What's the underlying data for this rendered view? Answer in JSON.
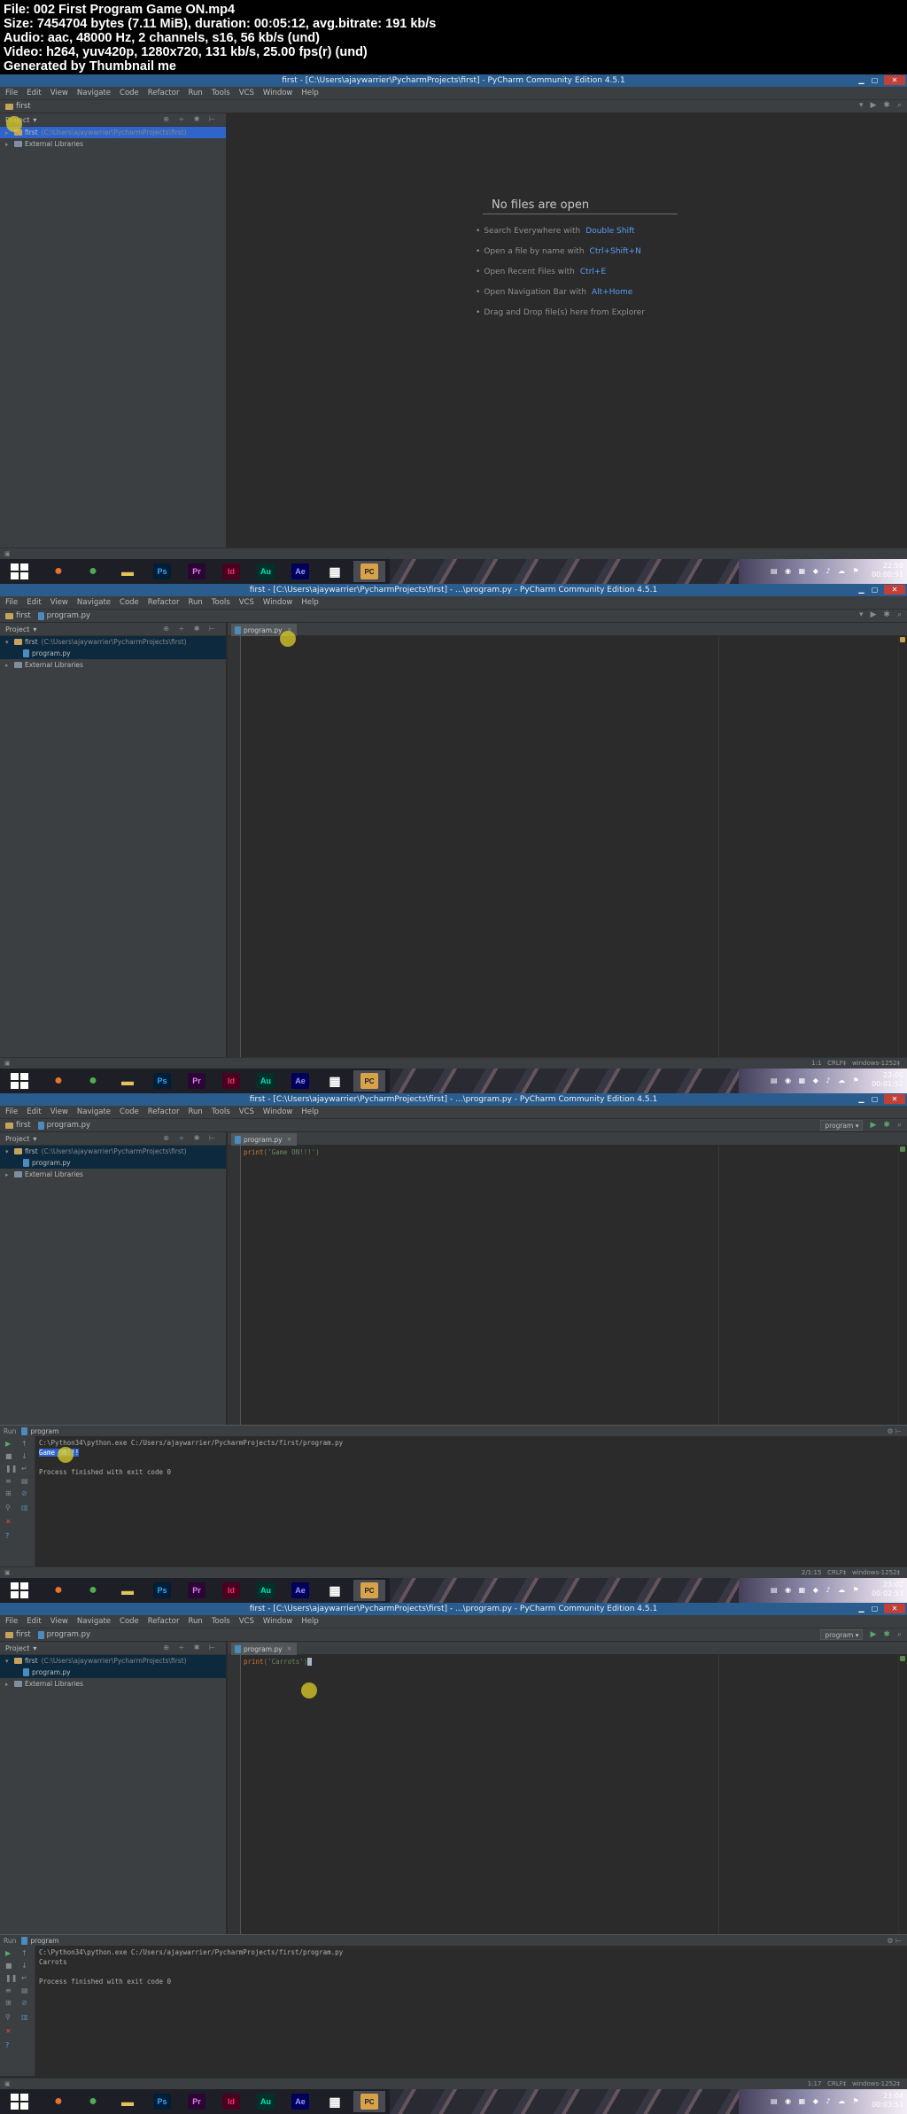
{
  "header": {
    "line1": "File: 002 First Program  Game ON.mp4",
    "line2": "Size: 7454704 bytes (7.11 MiB), duration: 00:05:12, avg.bitrate: 191 kb/s",
    "line3": "Audio: aac, 48000 Hz, 2 channels, s16, 56 kb/s (und)",
    "line4": "Video: h264, yuv420p, 1280x720, 131 kb/s, 25.00 fps(r) (und)",
    "line5": "Generated by Thumbnail me"
  },
  "menu": [
    "File",
    "Edit",
    "View",
    "Navigate",
    "Code",
    "Refactor",
    "Run",
    "Tools",
    "VCS",
    "Window",
    "Help"
  ],
  "project": {
    "panel_label": "Project",
    "root_name": "first",
    "root_path": "(C:\\Users\\ajaywarrier\\PycharmProjects\\first)",
    "file_name": "program.py",
    "external": "External Libraries"
  },
  "frames": [
    {
      "title": "first - [C:\\Users\\ajaywarrier\\PycharmProjects\\first] - PyCharm Community Edition 4.5.1",
      "empty": {
        "heading": "No files are open",
        "hints": [
          {
            "text": "Search Everywhere with",
            "key": "Double Shift"
          },
          {
            "text": "Open a file by name with",
            "key": "Ctrl+Shift+N"
          },
          {
            "text": "Open Recent Files with",
            "key": "Ctrl+E"
          },
          {
            "text": "Open Navigation Bar with",
            "key": "Alt+Home"
          },
          {
            "text": "Drag and Drop file(s) here from Explorer",
            "key": ""
          }
        ]
      },
      "clock_time": "22:58",
      "clock_date": "00:00:51"
    },
    {
      "title": "first - [C:\\Users\\ajaywarrier\\PycharmProjects\\first] - ...\\program.py - PyCharm Community Edition 4.5.1",
      "tab": "program.py",
      "status": "1:1   CRLF‡   windows-1252‡",
      "clock_time": "23:00",
      "clock_date": "00:01:52"
    },
    {
      "title": "first - [C:\\Users\\ajaywarrier\\PycharmProjects\\first] - ...\\program.py - PyCharm Community Edition 4.5.1",
      "tab": "program.py",
      "run_config": "program",
      "code_kw": "print",
      "code_str": "('Game ON!!!')",
      "run_label": "Run",
      "run_tab": "program",
      "console": [
        "C:\\Python34\\python.exe C:/Users/ajaywarrier/PycharmProjects/first/program.py",
        "Game ON!!!",
        "",
        "Process finished with exit code 0"
      ],
      "status": "2/1:15   CRLF‡   windows-1252‡",
      "clock_time": "23:02",
      "clock_date": "00:02:53"
    },
    {
      "title": "first - [C:\\Users\\ajaywarrier\\PycharmProjects\\first] - ...\\program.py - PyCharm Community Edition 4.5.1",
      "tab": "program.py",
      "run_config": "program",
      "code_kw": "print",
      "code_str": "('Carrots')",
      "run_label": "Run",
      "run_tab": "program",
      "console": [
        "C:\\Python34\\python.exe C:/Users/ajaywarrier/PycharmProjects/first/program.py",
        "Carrots",
        "",
        "Process finished with exit code 0"
      ],
      "status": "1:17   CRLF‡   windows-1252‡",
      "clock_time": "23:04",
      "clock_date": "00:03:53"
    }
  ],
  "taskbar_apps": [
    {
      "name": "firefox",
      "glyph": "●",
      "color": "#e8742c"
    },
    {
      "name": "chrome",
      "glyph": "●",
      "color": "#4caf50"
    },
    {
      "name": "explorer",
      "glyph": "▬",
      "color": "#e6c25a"
    },
    {
      "name": "photoshop",
      "glyph": "Ps",
      "color": "#31a8ff"
    },
    {
      "name": "premiere",
      "glyph": "Pr",
      "color": "#e77cf5"
    },
    {
      "name": "indesign",
      "glyph": "Id",
      "color": "#ff3366"
    },
    {
      "name": "audition",
      "glyph": "Au",
      "color": "#00e4bb"
    },
    {
      "name": "after-effects",
      "glyph": "Ae",
      "color": "#9999ff"
    },
    {
      "name": "windows-app",
      "glyph": "▦",
      "color": "#ffffff"
    },
    {
      "name": "pycharm",
      "glyph": "PC",
      "color": "#ffffff"
    }
  ],
  "colors": {
    "accent": "#2f65ca",
    "titlebar": "#2a5c8e",
    "titlebar_active": "#c9a393",
    "close": "#c1403a"
  }
}
